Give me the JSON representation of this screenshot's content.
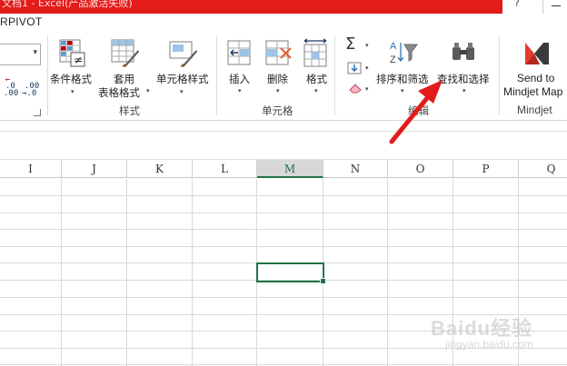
{
  "window": {
    "title_fragment": "文档1 - Excel(产品激活失败)",
    "help": "?"
  },
  "tab": {
    "label": "RPIVOT"
  },
  "ribbon": {
    "number": {
      "inc_decimal": [
        ".0",
        ".00"
      ],
      "dec_decimal": [
        ".00",
        "→.0"
      ]
    },
    "styles": {
      "group_label": "样式",
      "conditional_format": "条件格式",
      "format_as_table_1": "套用",
      "format_as_table_2": "表格格式",
      "cell_styles": "单元格样式"
    },
    "cells": {
      "group_label": "单元格",
      "insert": "插入",
      "delete": "删除",
      "format": "格式"
    },
    "editing": {
      "group_label": "编辑",
      "sum_symbol": "Σ",
      "sort_filter": "排序和筛选",
      "find_select": "查找和选择"
    },
    "mindjet": {
      "group_label": "Mindjet",
      "send_line1": "Send to",
      "send_line2": "Mindjet Map"
    }
  },
  "sheet": {
    "columns": [
      "I",
      "J",
      "K",
      "L",
      "M",
      "N",
      "O",
      "P",
      "Q"
    ],
    "selected_column": "M"
  },
  "annotation": {
    "arrow_color": "#e31b1b"
  },
  "watermark": {
    "line1": "Baidu经验",
    "line2": "jingyan.baidu.com"
  },
  "colors": {
    "title_red": "#e31b1b",
    "excel_green": "#217346"
  }
}
